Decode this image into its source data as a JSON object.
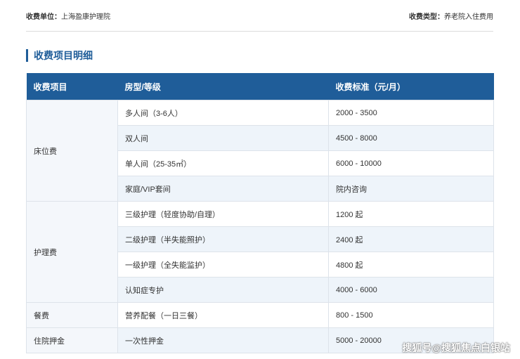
{
  "header": {
    "unit_label": "收费单位：",
    "unit_value": "上海盈康护理院",
    "type_label": "收费类型：",
    "type_value": "养老院入住费用"
  },
  "section": {
    "title": "收费项目明细"
  },
  "table": {
    "headers": [
      "收费项目",
      "房型/等级",
      "收费标准（元/月）"
    ],
    "groups": [
      {
        "category": "床位费",
        "rows": [
          {
            "item": "多人间（3-6人）",
            "price": "2000 - 3500"
          },
          {
            "item": "双人间",
            "price": "4500 - 8000"
          },
          {
            "item": "单人间（25-35㎡）",
            "price": "6000 - 10000"
          },
          {
            "item": "家庭/VIP套间",
            "price": "院内咨询"
          }
        ]
      },
      {
        "category": "护理费",
        "rows": [
          {
            "item": "三级护理（轻度协助/自理）",
            "price": "1200 起"
          },
          {
            "item": "二级护理（半失能照护）",
            "price": "2400 起"
          },
          {
            "item": "一级护理（全失能监护）",
            "price": "4800 起"
          },
          {
            "item": "认知症专护",
            "price": "4000 - 6000"
          }
        ]
      },
      {
        "category": "餐费",
        "rows": [
          {
            "item": "营养配餐（一日三餐）",
            "price": "800 - 1500"
          }
        ]
      },
      {
        "category": "住院押金",
        "rows": [
          {
            "item": "一次性押金",
            "price": "5000 - 20000"
          }
        ]
      }
    ]
  },
  "watermark": "搜狐号@搜狐焦点白银站"
}
